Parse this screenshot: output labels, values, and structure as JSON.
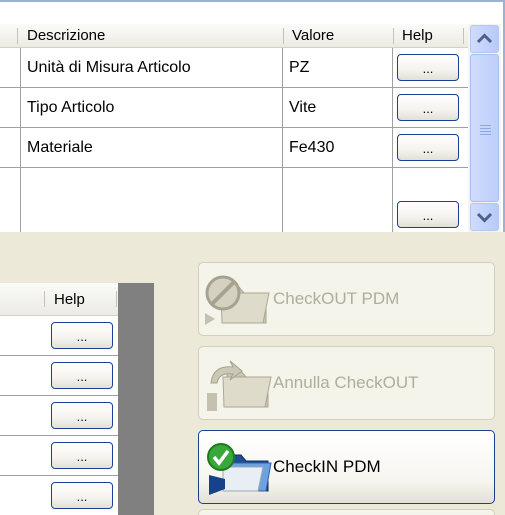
{
  "top_grid": {
    "columns": [
      "Descrizione",
      "Valore",
      "Help"
    ],
    "rows": [
      {
        "descrizione": "Unità di Misura Articolo",
        "valore": "PZ",
        "help": "..."
      },
      {
        "descrizione": "Tipo Articolo",
        "valore": "Vite",
        "help": "..."
      },
      {
        "descrizione": "Materiale",
        "valore": "Fe430",
        "help": "..."
      },
      {
        "descrizione": "",
        "valore": "",
        "help": "..."
      }
    ]
  },
  "bottom_grid": {
    "columns": [
      "Help"
    ],
    "rows": [
      "...",
      "...",
      "...",
      "...",
      "..."
    ]
  },
  "actions": {
    "checkout": "CheckOUT PDM",
    "undo_checkout": "Annulla CheckOUT",
    "checkin": "CheckIN PDM"
  },
  "colors": {
    "window_bg": "#ece9d8",
    "button_border": "#1c3f94",
    "disabled_text": "#b0ad9c",
    "scrollbar": "#c6d5fb"
  }
}
